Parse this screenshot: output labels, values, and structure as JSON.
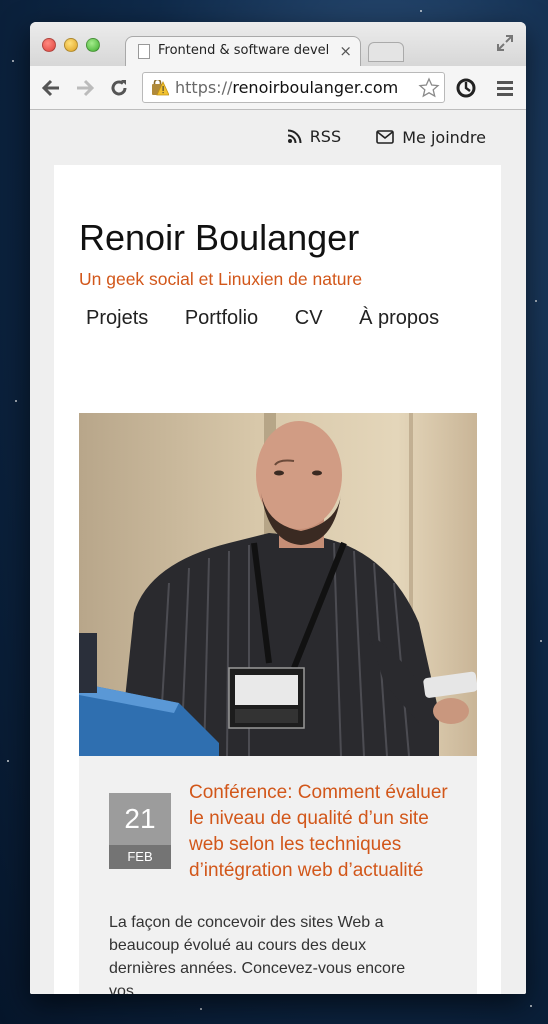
{
  "browser": {
    "tab_title": "Frontend & software developer",
    "tab_close": "×",
    "url_scheme": "https://",
    "url_host": "renoirboulanger.com"
  },
  "topnav": {
    "rss_label": "RSS",
    "contact_label": "Me joindre"
  },
  "site": {
    "title": "Renoir Boulanger",
    "tagline": "Un geek social et Linuxien de nature",
    "accent_color": "#d2571a"
  },
  "mainnav": {
    "items": [
      "Projets",
      "Portfolio",
      "CV",
      "À propos"
    ]
  },
  "post": {
    "date_day": "21",
    "date_month": "FEB",
    "title": "Conférence: Comment évaluer le niveau de qualité d’un site web selon les techniques d’intégration web d’actualité",
    "excerpt": "La façon de concevoir des sites Web a beaucoup évolué au cours des deux dernières années. Concevez-vous encore vos"
  }
}
